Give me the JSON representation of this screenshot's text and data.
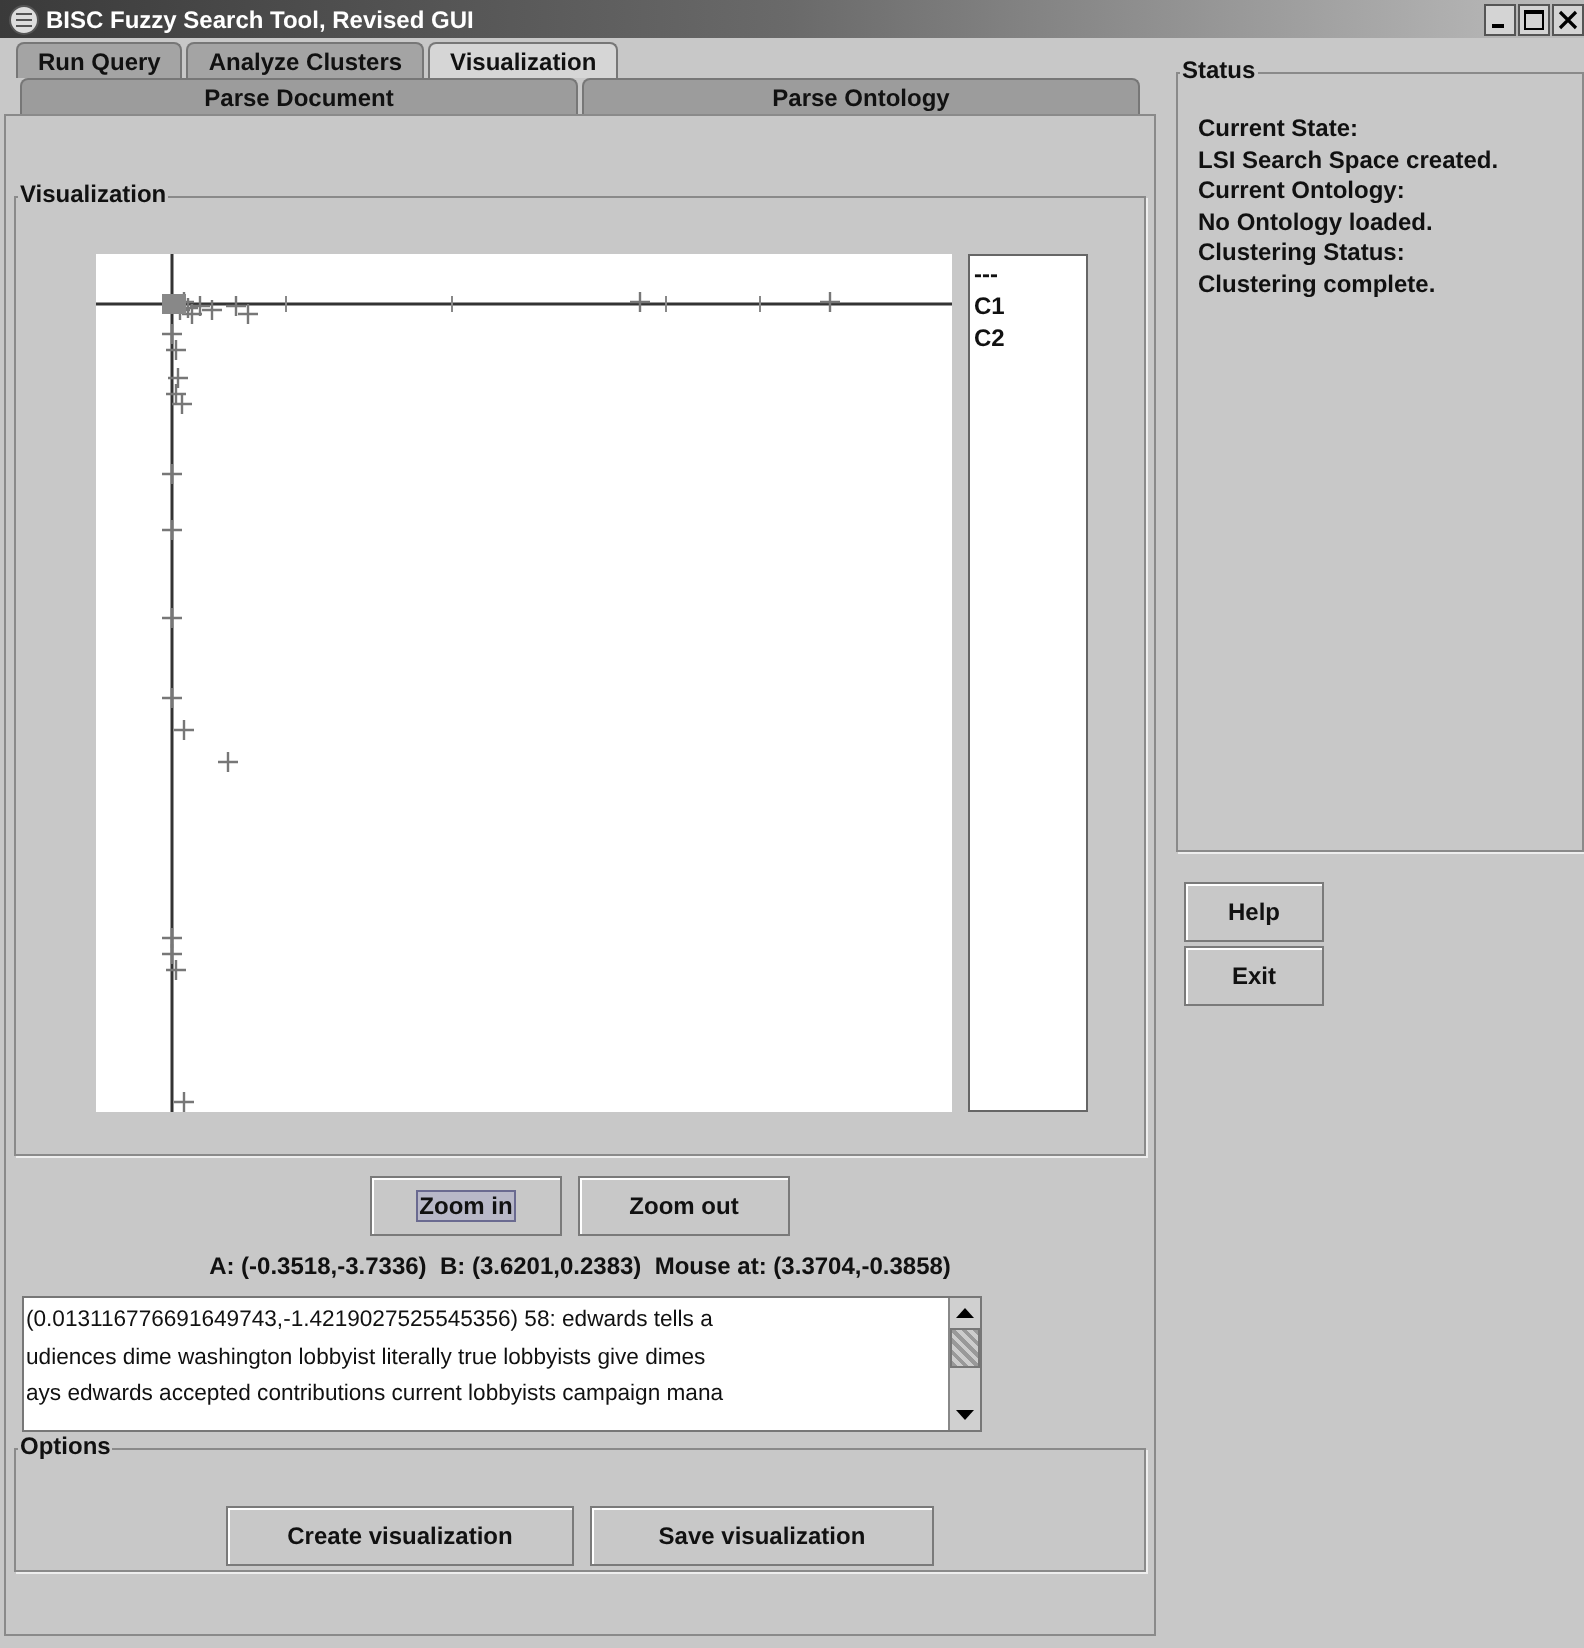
{
  "window": {
    "title": "BISC Fuzzy Search Tool, Revised GUI"
  },
  "tab_rows": [
    [
      {
        "label": "Run Query",
        "selected": false
      },
      {
        "label": "Analyze Clusters",
        "selected": false
      },
      {
        "label": "Visualization",
        "selected": true
      }
    ],
    [
      {
        "label": "Parse Document",
        "selected": false
      },
      {
        "label": "Parse Ontology",
        "selected": false
      }
    ]
  ],
  "visualization": {
    "title": "Visualization",
    "legend": [
      "---",
      "C1",
      "C2"
    ],
    "zoom_buttons": [
      {
        "label": "Zoom in",
        "focused": true
      },
      {
        "label": "Zoom out",
        "focused": false
      }
    ],
    "coordinates": "A: (-0.3518,-3.7336)  B: (3.6201,0.2383)  Mouse at: (3.3704,-0.3858)",
    "output_lines": [
      "(0.013116776691649743,-1.4219027525545356) 58: edwards tells a",
      "udiences dime washington lobbyist literally true lobbyists give dimes",
      "ays edwards accepted contributions current lobbyists campaign mana"
    ]
  },
  "options": {
    "title": "Options",
    "buttons": [
      "Create visualization",
      "Save visualization"
    ]
  },
  "status": {
    "title": "Status",
    "lines": [
      "Current State:",
      "LSI Search Space created.",
      "Current Ontology:",
      "No Ontology loaded.",
      "Clustering Status:",
      "Clustering complete."
    ]
  },
  "side_buttons": [
    "Help",
    "Exit"
  ]
}
